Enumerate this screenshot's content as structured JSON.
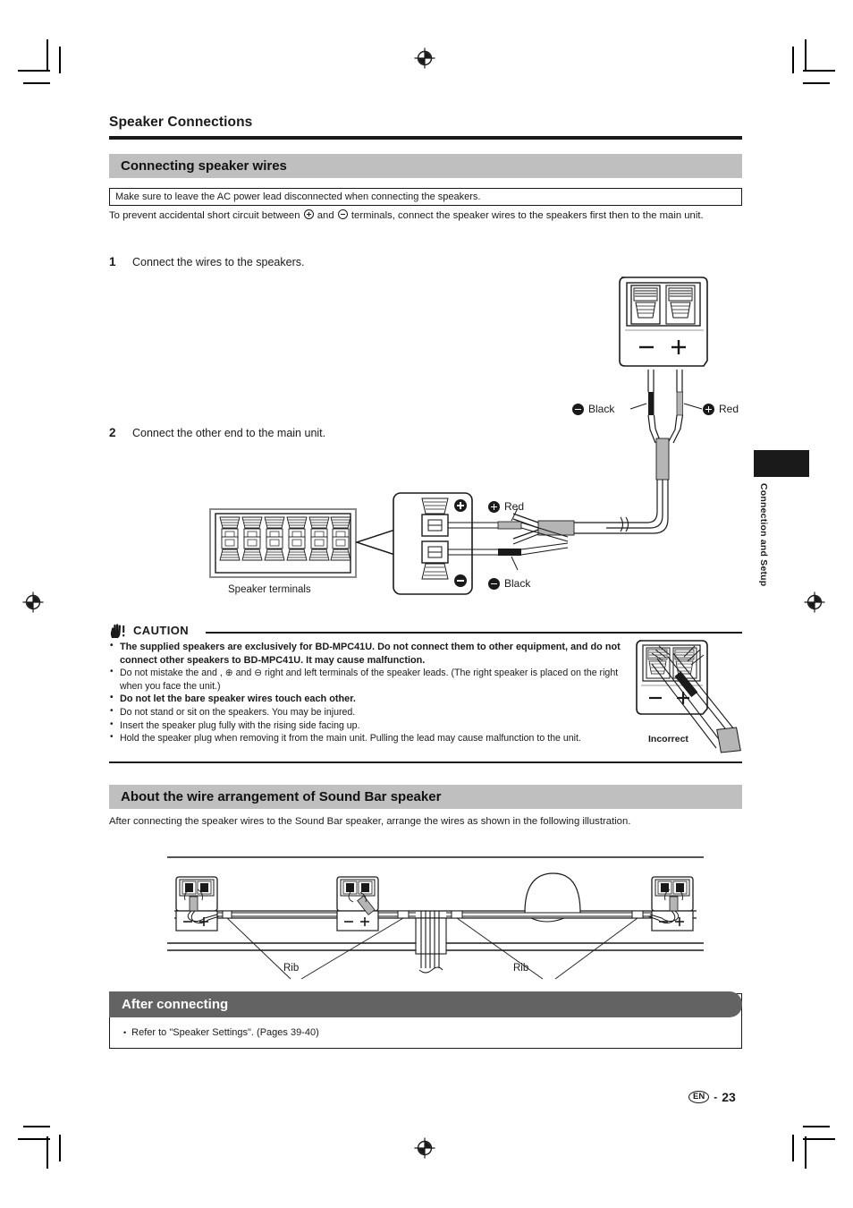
{
  "section": {
    "title": "Speaker Connections"
  },
  "banners": {
    "connecting_speaker_wires": "Connecting speaker wires",
    "wire_arrangement": "About the wire arrangement of Sound Bar speaker",
    "after_connecting": "After connecting"
  },
  "notice_box": "Make sure to leave the AC power lead disconnected when connecting the speakers.",
  "intro_paragraph": {
    "before_plus": "To prevent accidental short circuit between ",
    "between": " and ",
    "after_minus": " terminals, connect the speaker wires to the speakers first then to the main unit."
  },
  "steps": [
    {
      "num": "1",
      "text": "Connect the wires to the speakers."
    },
    {
      "num": "2",
      "text": "Connect the other end to the main unit."
    }
  ],
  "figure_labels": {
    "black": "Black",
    "red": "Red",
    "speaker_terminals": "Speaker terminals",
    "rib_left": "Rib",
    "rib_right": "Rib",
    "minus_glyph": "−",
    "plus_glyph": "+",
    "incorrect": "Incorrect"
  },
  "caution": {
    "title": "CAUTION",
    "items": [
      {
        "text": "The supplied speakers are exclusively for BD-MPC41U. Do not connect them to other equipment, and do not connect other speakers to BD-MPC41U. It may cause malfunction.",
        "bold": true
      },
      {
        "text": "Do not mistake the and ,  ⊕  and  ⊖  right and left terminals of the speaker leads. (The right speaker is placed on the right when you face the unit.)",
        "bold": false
      },
      {
        "text": "Do not let the bare speaker wires touch each other.",
        "bold": true
      },
      {
        "text": "Do not stand or sit on the speakers. You may be injured.",
        "bold": false
      },
      {
        "text": "Insert the speaker plug fully with the rising side facing up.",
        "bold": false
      },
      {
        "text": "Hold the speaker plug when removing it from the main unit. Pulling the lead may cause malfunction to the unit.",
        "bold": false
      }
    ]
  },
  "wire_arrangement_paragraph": "After connecting the speaker wires to the Sound Bar speaker, arrange the wires as shown in the following illustration.",
  "after_connecting_items": [
    "Refer to \"Speaker Settings\". (Pages 39-40)"
  ],
  "side_tab": {
    "text": "Connection and Setup"
  },
  "footer": {
    "locale": "EN",
    "dash": "-",
    "page": "23"
  },
  "colors": {
    "band_gray": "#bfbfbf",
    "after_header_gray": "#636363",
    "ink": "#1a1a1a",
    "wire_gray": "#b5b5b5",
    "wire_black": "#1a1a1a"
  }
}
